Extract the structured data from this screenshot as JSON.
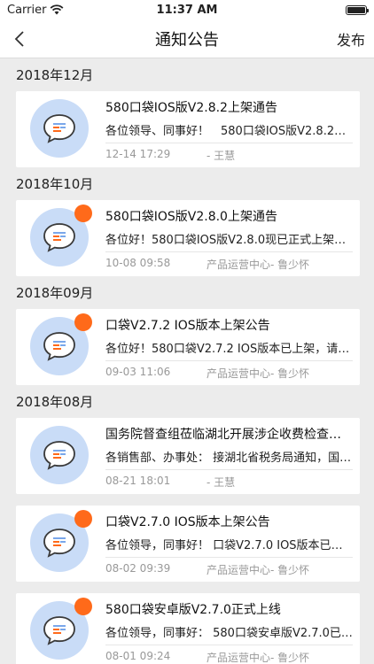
{
  "status_bar": {
    "carrier": "Carrier",
    "time": "11:37 AM"
  },
  "nav": {
    "title": "通知公告",
    "publish": "发布"
  },
  "groups": [
    {
      "header": "2018年12月",
      "items": [
        {
          "title": "580口袋IOS版V2.8.2上架通告",
          "summary": "各位领导、同事好！　580口袋IOS版V2.8.2已正式上架",
          "date": "12-14 17:29",
          "author": "- 王慧",
          "unread": false
        }
      ]
    },
    {
      "header": "2018年10月",
      "items": [
        {
          "title": "580口袋IOS版V2.8.0上架通告",
          "summary": "各位好！580口袋IOS版V2.8.0现已正式上架，请大家更新",
          "date": "10-08 09:58",
          "author": "产品运营中心- 鲁少怀",
          "unread": true
        }
      ]
    },
    {
      "header": "2018年09月",
      "items": [
        {
          "title": "口袋V2.7.2 IOS版本上架公告",
          "summary": "各位好！580口袋V2.7.2 IOS版本已上架，请大家更新",
          "date": "09-03 11:06",
          "author": "产品运营中心- 鲁少怀",
          "unread": true
        }
      ]
    },
    {
      "header": "2018年08月",
      "items": [
        {
          "title": "国务院督查组莅临湖北开展涉企收费检查工作",
          "summary": "各销售部、办事处：  接湖北省税务局通知，国务院督查组",
          "date": "08-21 18:01",
          "author": "- 王慧",
          "unread": false
        },
        {
          "title": "口袋V2.7.0 IOS版本上架公告",
          "summary": "各位领导，同事好！  口袋V2.7.0 IOS版本已正式上架",
          "date": "08-02 09:39",
          "author": "产品运营中心- 鲁少怀",
          "unread": true
        },
        {
          "title": "580口袋安卓版V2.7.0正式上线",
          "summary": "各位领导，同事好：  580口袋安卓版V2.7.0已正式上线",
          "date": "08-01 09:24",
          "author": "产品运营中心- 鲁少怀",
          "unread": true
        }
      ]
    }
  ]
}
